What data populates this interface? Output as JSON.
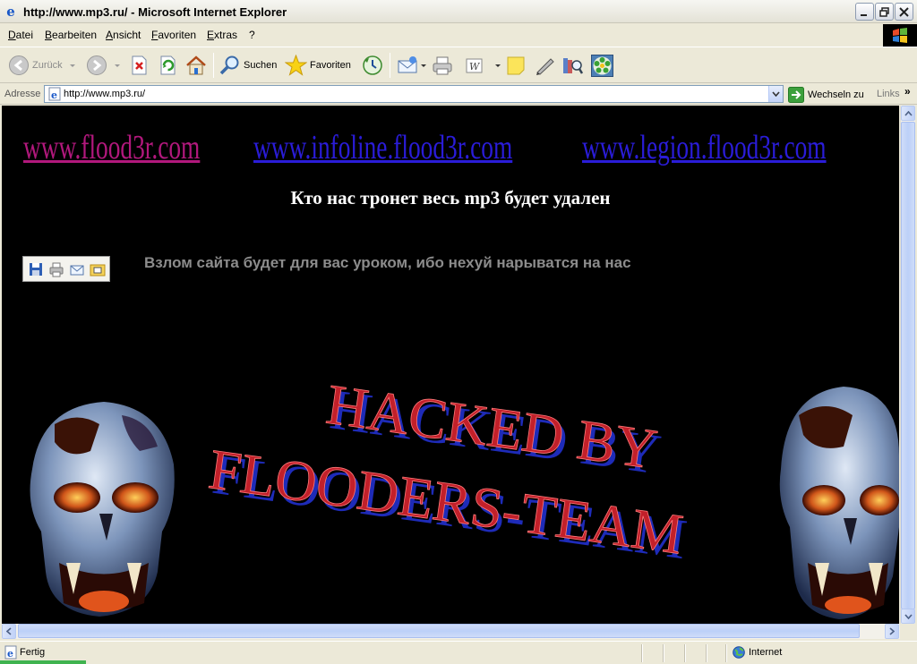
{
  "window": {
    "title": "http://www.mp3.ru/ - Microsoft Internet Explorer"
  },
  "menu": [
    "Datei",
    "Bearbeiten",
    "Ansicht",
    "Favoriten",
    "Extras",
    "?"
  ],
  "toolbar": {
    "back_label": "Zurück",
    "search_label": "Suchen",
    "favorites_label": "Favoriten"
  },
  "address": {
    "label": "Adresse",
    "url": "http://www.mp3.ru/",
    "go_label": "Wechseln zu",
    "links_label": "Links"
  },
  "page": {
    "links": [
      "www.flood3r.com",
      "www.infoline.flood3r.com",
      "www.legion.flood3r.com"
    ],
    "headline": "Кто нас тронет весь mp3 будет удален",
    "subline": "Взлом сайта будет для вас уроком, ибо нехуй нарыватся на нас",
    "banner_line1": "HACKED BY",
    "banner_line2": "FLOODERS-TEAM"
  },
  "status": {
    "text": "Fertig",
    "zone": "Internet"
  },
  "colors": {
    "visited_link": "#b1187c",
    "link": "#2a1cd8",
    "banner_fill": "#c2202a",
    "page_background": "#000000"
  }
}
